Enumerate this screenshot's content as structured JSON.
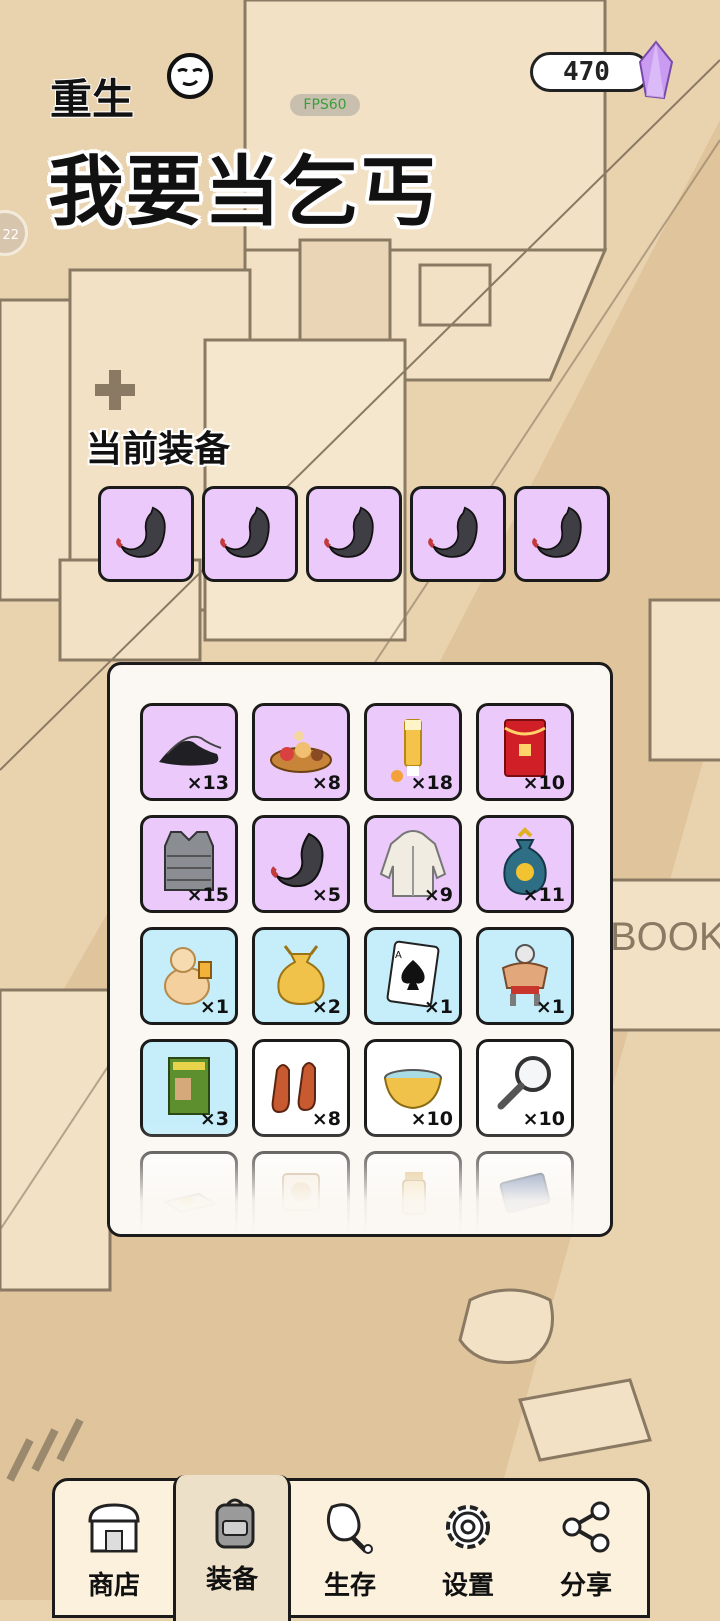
{
  "header": {
    "title_line1": "重生",
    "title_line2": "我要当乞丐",
    "fps_label": "FPS60",
    "gem_count": "470",
    "side_badge": "22"
  },
  "equipment": {
    "title": "当前装备",
    "slots": [
      {
        "icon": "stomach-icon"
      },
      {
        "icon": "stomach-icon"
      },
      {
        "icon": "stomach-icon"
      },
      {
        "icon": "stomach-icon"
      },
      {
        "icon": "stomach-icon"
      }
    ]
  },
  "inventory": {
    "items": [
      {
        "icon": "cloth-shoes-icon",
        "qty": "×13",
        "rarity": "purple"
      },
      {
        "icon": "dessert-plate-icon",
        "qty": "×8",
        "rarity": "purple"
      },
      {
        "icon": "sunscreen-tube-icon",
        "qty": "×18",
        "rarity": "purple"
      },
      {
        "icon": "red-envelope-icon",
        "qty": "×10",
        "rarity": "purple"
      },
      {
        "icon": "bulletproof-vest-icon",
        "qty": "×15",
        "rarity": "purple"
      },
      {
        "icon": "stomach-icon",
        "qty": "×5",
        "rarity": "purple"
      },
      {
        "icon": "hoodie-icon",
        "qty": "×9",
        "rarity": "purple"
      },
      {
        "icon": "money-bag-icon",
        "qty": "×11",
        "rarity": "purple"
      },
      {
        "icon": "fat-man-beer-icon",
        "qty": "×1",
        "rarity": "blue"
      },
      {
        "icon": "cloth-sack-icon",
        "qty": "×2",
        "rarity": "blue"
      },
      {
        "icon": "ace-of-spades-icon",
        "qty": "×1",
        "rarity": "blue"
      },
      {
        "icon": "masked-wrestler-icon",
        "qty": "×1",
        "rarity": "blue"
      },
      {
        "icon": "book-icon",
        "qty": "×3",
        "rarity": "blue"
      },
      {
        "icon": "gloves-icon",
        "qty": "×8",
        "rarity": "white"
      },
      {
        "icon": "bowl-icon",
        "qty": "×10",
        "rarity": "white"
      },
      {
        "icon": "magnifier-icon",
        "qty": "×10",
        "rarity": "white"
      },
      {
        "icon": "box-icon",
        "qty": "",
        "rarity": "white"
      },
      {
        "icon": "plate-icon",
        "qty": "",
        "rarity": "white"
      },
      {
        "icon": "kettle-icon",
        "qty": "",
        "rarity": "white"
      },
      {
        "icon": "card-icon",
        "qty": "",
        "rarity": "white"
      }
    ]
  },
  "nav": {
    "items": [
      {
        "label": "商店",
        "icon": "shop-icon"
      },
      {
        "label": "装备",
        "icon": "backpack-icon"
      },
      {
        "label": "生存",
        "icon": "chicken-leg-icon"
      },
      {
        "label": "设置",
        "icon": "gear-icon"
      },
      {
        "label": "分享",
        "icon": "share-icon"
      }
    ],
    "active_index": 1
  },
  "colors": {
    "background": "#e9d2ae",
    "purple_rarity": "#ebc9fb",
    "blue_rarity": "#c5eefa",
    "white_rarity": "#ffffff",
    "gem": "#c99cf2"
  }
}
